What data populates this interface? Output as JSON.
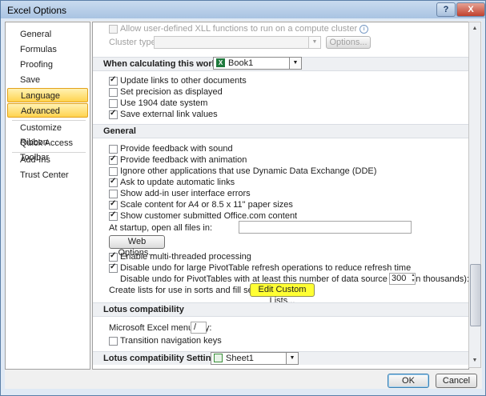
{
  "window": {
    "title": "Excel Options",
    "help_label": "?",
    "close_label": "X"
  },
  "nav": {
    "items": [
      {
        "label": "General",
        "selected": false
      },
      {
        "label": "Formulas",
        "selected": false
      },
      {
        "label": "Proofing",
        "selected": false
      },
      {
        "label": "Save",
        "selected": false
      },
      {
        "label": "Language",
        "selected": true
      },
      {
        "label": "Advanced",
        "selected": true
      },
      {
        "label": "Customize Ribbon",
        "selected": false
      },
      {
        "label": "Quick Access Toolbar",
        "selected": false
      },
      {
        "label": "Add-Ins",
        "selected": false
      },
      {
        "label": "Trust Center",
        "selected": false
      }
    ]
  },
  "top": {
    "xll_label": "Allow user-defined XLL functions to run on a compute cluster",
    "info_icon": "info-icon",
    "cluster_type_label": "Cluster type:",
    "options_button": "Options..."
  },
  "calc": {
    "section_label": "When calculating this workbook:",
    "workbook": "Book1",
    "options": [
      {
        "label": "Update links to other documents",
        "checked": true
      },
      {
        "label": "Set precision as displayed",
        "checked": false
      },
      {
        "label": "Use 1904 date system",
        "checked": false
      },
      {
        "label": "Save external link values",
        "checked": true
      }
    ]
  },
  "general": {
    "section_label": "General",
    "options": [
      {
        "label": "Provide feedback with sound",
        "checked": false
      },
      {
        "label": "Provide feedback with animation",
        "checked": true
      },
      {
        "label": "Ignore other applications that use Dynamic Data Exchange (DDE)",
        "checked": false
      },
      {
        "label": "Ask to update automatic links",
        "checked": true
      },
      {
        "label": "Show add-in user interface errors",
        "checked": false
      },
      {
        "label": "Scale content for A4 or 8.5 x 11\" paper sizes",
        "checked": true
      },
      {
        "label": "Show customer submitted Office.com content",
        "checked": true
      }
    ],
    "startup_label": "At startup, open all files in:",
    "startup_value": "",
    "web_options_button": "Web Options...",
    "multithread_label": "Enable multi-threaded processing",
    "multithread_checked": true,
    "disable_undo_label": "Disable undo for large PivotTable refresh operations to reduce refresh time",
    "disable_undo_checked": true,
    "pivot_rows_label": "Disable undo for PivotTables with at least this number of data source rows (in thousands):",
    "pivot_rows_value": "300",
    "custom_lists_label": "Create lists for use in sorts and fill sequences:",
    "custom_lists_button": "Edit Custom Lists..."
  },
  "lotus": {
    "section_label": "Lotus compatibility",
    "menu_key_label": "Microsoft Excel menu key:",
    "menu_key_value": "/",
    "transition_label": "Transition navigation keys",
    "transition_checked": false,
    "settings_label": "Lotus compatibility Settings for:",
    "settings_value": "Sheet1"
  },
  "footer": {
    "ok": "OK",
    "cancel": "Cancel"
  },
  "colors": {
    "highlight": "#ffff33",
    "selected_nav": "#ffd34f",
    "excel_green": "#1f7a3d"
  }
}
